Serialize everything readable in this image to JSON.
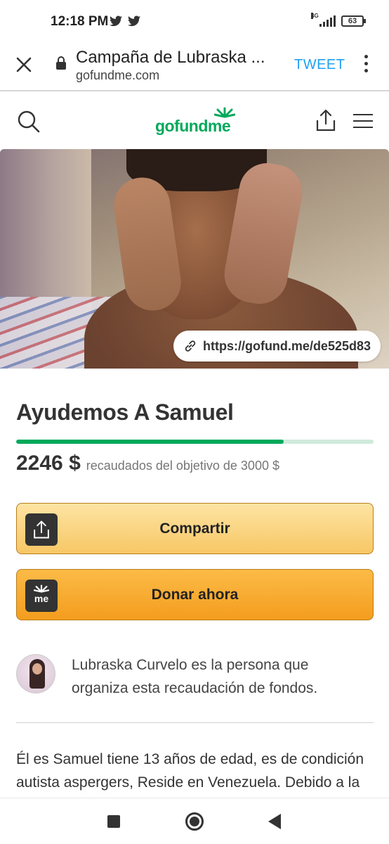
{
  "status_bar": {
    "time": "12:18 PM",
    "network": "4G",
    "battery": "63"
  },
  "browser": {
    "title": "Campaña de Lubraska ...",
    "url": "gofundme.com",
    "tweet_label": "TWEET"
  },
  "site": {
    "logo_text": "gofundme",
    "brand_color": "#02a95c"
  },
  "hero": {
    "short_link": "https://gofund.me/de525d83"
  },
  "campaign": {
    "title": "Ayudemos A Samuel",
    "raised": "2246 $",
    "goal_text": "recaudados del objetivo de 3000 $",
    "progress_fraction": 0.7487
  },
  "buttons": {
    "share": "Compartir",
    "donate": "Donar ahora",
    "donate_icon_text": "me"
  },
  "organizer": {
    "text": "Lubraska Curvelo es la persona que organiza esta recaudación de fondos."
  },
  "story": {
    "text": "Él es Samuel tiene 13 años de edad, es de condición autista aspergers, Reside en Venezuela. Debido a la"
  },
  "icons": {
    "close": "close-icon",
    "lock": "lock-icon",
    "more": "more-vert-icon",
    "search": "search-icon",
    "share": "share-icon",
    "menu": "hamburger-icon",
    "link": "link-icon",
    "twitter": "twitter-icon"
  }
}
